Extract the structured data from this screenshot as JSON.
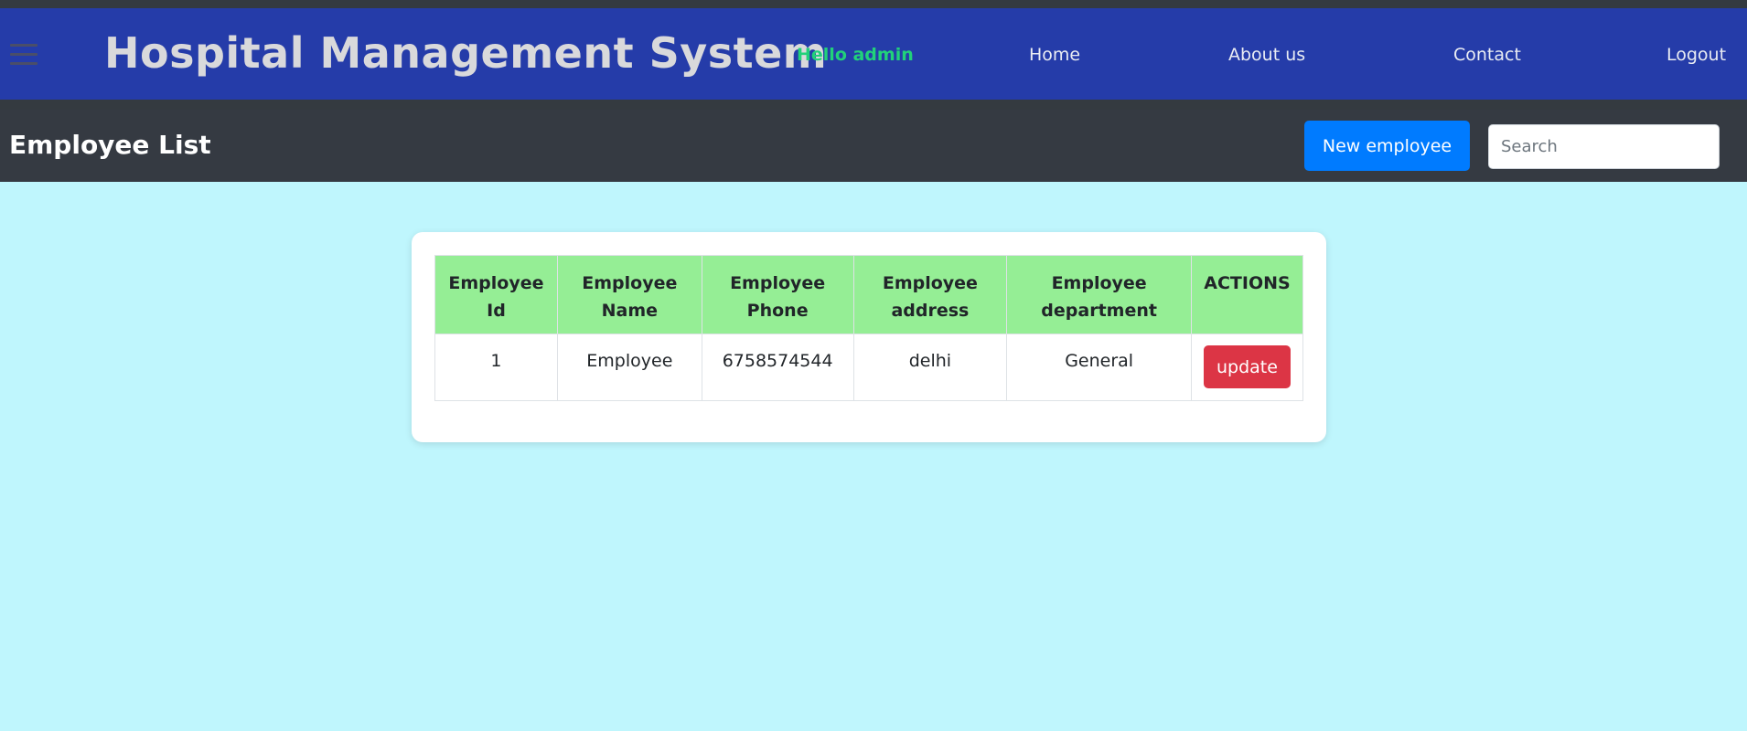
{
  "header": {
    "app_title": "Hospital Management System",
    "greeting": "Hello admin",
    "nav": {
      "home": "Home",
      "about": "About us",
      "contact": "Contact",
      "logout": "Logout"
    }
  },
  "toolbar": {
    "page_title": "Employee List",
    "new_button_label": "New employee",
    "search_placeholder": "Search",
    "search_value": ""
  },
  "table": {
    "headers": [
      "Employee Id",
      "Employee Name",
      "Employee Phone",
      "Employee address",
      "Employee department",
      "ACTIONS"
    ],
    "rows": [
      {
        "id": "1",
        "name": "Employee",
        "phone": "6758574544",
        "address": "delhi",
        "department": "General",
        "action_label": "update"
      }
    ]
  },
  "colors": {
    "header_bg": "#253ca9",
    "toolbar_bg": "#353a42",
    "page_bg": "#bff6fd",
    "table_header_bg": "#95ee95",
    "primary_button": "#007bff",
    "danger_button": "#dc3545",
    "greeting_text": "#21d17a"
  },
  "icons": {
    "menu": "hamburger-menu-icon"
  }
}
